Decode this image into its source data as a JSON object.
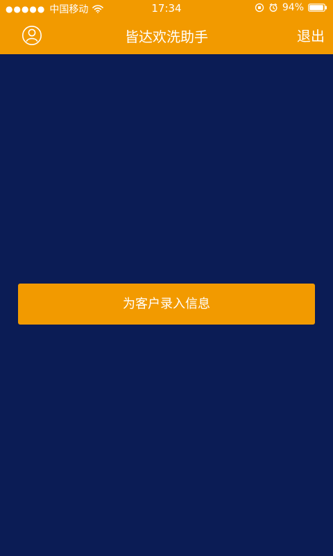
{
  "status_bar": {
    "signal_dots": "●●●●●",
    "carrier": "中国移动",
    "time": "17:34",
    "battery_percent": "94%"
  },
  "header": {
    "title": "皆达欢洗助手",
    "logout_label": "退出",
    "avatar_icon": "user-outline-icon"
  },
  "main": {
    "enter_info_button_label": "为客户录入信息"
  },
  "colors": {
    "accent": "#f29a00",
    "background": "#0b1c55",
    "text": "#ffffff"
  }
}
